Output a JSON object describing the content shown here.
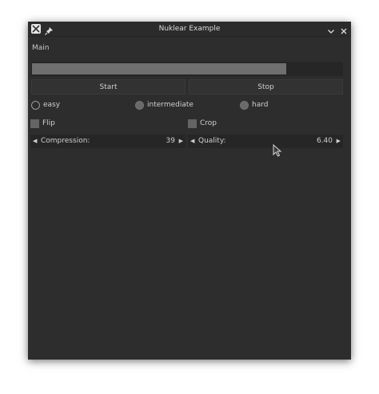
{
  "window": {
    "title": "Nuklear Example"
  },
  "main": {
    "section_label": "Main",
    "progress": 0.82,
    "buttons": {
      "start": "Start",
      "stop": "Stop"
    },
    "difficulty": {
      "options": [
        "easy",
        "intermediate",
        "hard"
      ],
      "selected": "easy"
    },
    "checkboxes": {
      "flip": {
        "label": "Flip",
        "checked": false
      },
      "crop": {
        "label": "Crop",
        "checked": false
      }
    },
    "properties": {
      "compression": {
        "label": "Compression:",
        "value": "39"
      },
      "quality": {
        "label": "Quality:",
        "value": "6.40"
      }
    }
  },
  "icons": {
    "app": "x-app-icon",
    "pin": "pin-icon",
    "minimize": "chevron-down-icon",
    "close": "close-icon",
    "left_arrow": "triangle-left-icon",
    "right_arrow": "triangle-right-icon"
  },
  "colors": {
    "window_bg": "#2d2d2d",
    "progress_fill": "#6f6f6f",
    "text": "#cfcfcf"
  }
}
